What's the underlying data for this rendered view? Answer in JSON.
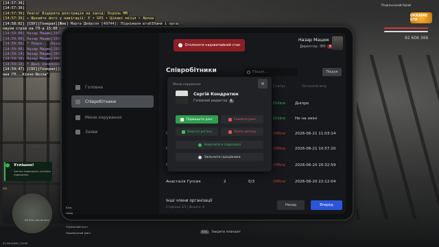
{
  "chat": [
    {
      "text": "[14:57:36]",
      "color": "#ffffff"
    },
    {
      "text": "[14:57:36]",
      "color": "#ffffff"
    },
    {
      "text": "[14:57:36] Увага! Відкрита реєстрація на захід: Король ММ",
      "color": "#f1e36a"
    },
    {
      "text": "[14:57:36] ✦ Шукайте його у навігації: Є • GPS • Цікаві місця • Арена",
      "color": "#f1e36a"
    },
    {
      "text": "[14:58:02] [СБУ][Генерал][Жив] Марта Двйдсон [49744]: Піднімаєм штабІбами і організ",
      "color": "#ffffff"
    },
    {
      "text": "овуєм стрій на ГП-а 15:00",
      "color": "#ffffff"
    },
    {
      "text": "[14:59:00] Назар Мацюк[19556] дістав планшет",
      "color": "#b98cf0"
    },
    {
      "text": "[14:59:00] Назар Мацюк[19556] почав шукати співробітника",
      "color": "#b98cf0"
    },
    {
      "text": "[14:59:06] * Пошук... Назар Мацюк[19556]",
      "color": "#b98cf0"
    },
    {
      "text": "[14:59:06] Назар Мацюк[19556] знайшов співробітника",
      "color": "#b98cf0"
    },
    {
      "text": "[14:59:14] Назар Мацюк[19556] натиснув на кнопку \"Підвищити ранг\"",
      "color": "#b98cf0"
    },
    {
      "text": "[14:59:16] Назар Мацюк[19556] оновив дані про співробітника",
      "color": "#b98cf0"
    },
    {
      "text": "[14:59:16] * Дані оновлено - Назар Мацюк[19556]",
      "color": "#b98cf0"
    },
    {
      "text": "[14:59:47] [СБУ][Генерал][Жив] Марта Двйдсон [49744]: СБУ спільно з ЗСУ та НПУ зібра",
      "color": "#ffffff"
    },
    {
      "text": "ння ГП...Кінче-Весла\"",
      "color": "#ffffff"
    }
  ],
  "hud": {
    "server_label": "Подільський Край",
    "logo": "UKRAINE GTA",
    "money": "92 606 366",
    "date_time": "21.06.2026 | 14:59"
  },
  "toast": {
    "title": "Успішно!",
    "body": "Змінне підвищено успішно підвищено"
  },
  "mini_hud": {
    "lines": [
      "0/0",
      "Біля",
      "Нема",
      "Таємничий пост",
      "Перевірений рівні"
    ],
    "map_label": "Ви біля відчинень"
  },
  "tablet": {
    "alert_text": "Оголосити надзвичайний стан",
    "user": {
      "name": "Назар Мацюк",
      "role": "Директор: ЗМІ",
      "badge": "8"
    },
    "nav": [
      {
        "label": "Головна",
        "icon": "home-icon",
        "active": false
      },
      {
        "label": "Співробітники",
        "icon": "users-icon",
        "active": true
      },
      {
        "label": "Меню керування",
        "icon": "menu-icon",
        "active": false
      },
      {
        "label": "Заяви",
        "icon": "document-icon",
        "active": false
      }
    ],
    "section_title": "Співробітники",
    "search_placeholder": "Пошук...",
    "search_button": "Пошук",
    "columns": [
      "Статус",
      "Останній вхід"
    ],
    "rows": [
      {
        "name": "",
        "rank": "",
        "warns": "",
        "status": "Online",
        "last": "Дніпро"
      },
      {
        "name": "",
        "rank": "",
        "warns": "",
        "status": "Online",
        "last": "Не на зміні"
      },
      {
        "name": "Г",
        "rank": "",
        "warns": "",
        "status": "Offline",
        "last": "2026-06-21 11:03:14"
      },
      {
        "name": "Г",
        "rank": "",
        "warns": "",
        "status": "Offline",
        "last": "2026-06-21 10:57:20"
      },
      {
        "name": "Г",
        "rank": "",
        "warns": "",
        "status": "Offline",
        "last": "2026-06-20 20:32:59"
      },
      {
        "name": "Анастасія Гупсик",
        "rank": "2",
        "warns": "0/3",
        "status": "Offline",
        "last": "2026-06-20 22:12:04"
      }
    ],
    "footer_title": "Інші члени організації",
    "footer_sub": "Сторінка 1/1 | Всього: 8",
    "back_button": "Назад",
    "next_button": "Вперед"
  },
  "modal": {
    "header": "Меню керування",
    "name": "Сергій Кондратюк",
    "role": "Головний редактор",
    "badge": "6",
    "buttons": {
      "promote": "Підвищити ранг",
      "demote": "Знизити ранг",
      "give_warn": "Видати догану",
      "remove_warn": "Зняти догану",
      "lock": "Закріпити в підрозділі",
      "fire": "Звільнити працівника"
    },
    "close": "×"
  },
  "hint": {
    "key": "ESC",
    "text": "Закрити планшет"
  },
  "colors": {
    "accent_blue": "#2c55d8",
    "online": "#3bb24f",
    "offline": "#d23b3b",
    "alert": "#8c1f26"
  }
}
